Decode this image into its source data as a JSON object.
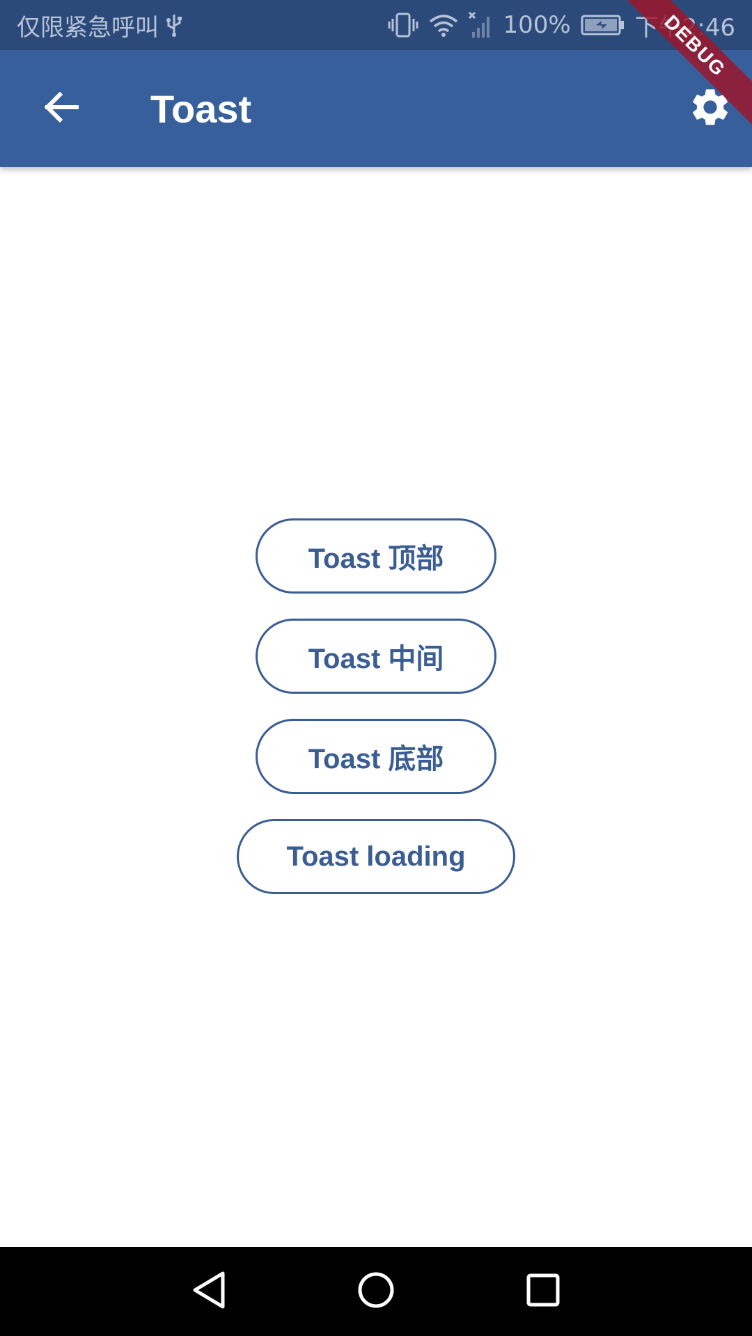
{
  "status_bar": {
    "carrier_text": "仅限紧急呼叫",
    "battery_percent": "100%",
    "time": "下午2:46",
    "icons": [
      "usb-icon",
      "vibrate-icon",
      "wifi-icon",
      "no-signal-icon",
      "battery-charging-icon"
    ]
  },
  "app_bar": {
    "title": "Toast",
    "back_icon": "arrow-back-icon",
    "settings_icon": "gear-icon"
  },
  "debug_banner": {
    "label": "DEBUG"
  },
  "buttons": {
    "toast_top": "Toast 顶部",
    "toast_center": "Toast 中间",
    "toast_bottom": "Toast 底部",
    "toast_loading": "Toast loading"
  },
  "nav_bar": {
    "icons": [
      "nav-back-icon",
      "nav-home-icon",
      "nav-recent-icon"
    ]
  },
  "colors": {
    "status_bar": "#2c4a79",
    "app_bar": "#365f9c",
    "button_outline": "#3a5d93",
    "background": "#ffffff",
    "nav_bar": "#000000",
    "debug_banner": "#a01428"
  }
}
